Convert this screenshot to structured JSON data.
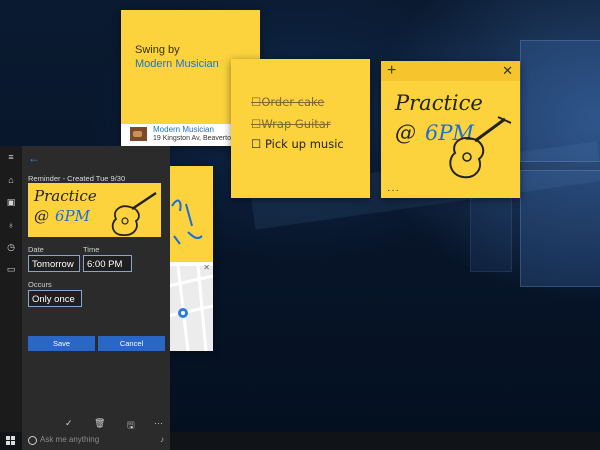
{
  "desktop_label": "Windows 10 desktop",
  "sticky_notes": {
    "note_1": {
      "line1": "Swing by",
      "line2": "Modern Musician",
      "attachment_title": "Modern Musician",
      "attachment_address": "19 Kingston Av, Beaverto"
    },
    "note_2": {
      "items": [
        {
          "text": "Order cake",
          "done": true
        },
        {
          "text": "Wrap Guitar",
          "done": true
        },
        {
          "text": "Pick up music",
          "done": false
        }
      ]
    },
    "note_3": {
      "line1": "Practice",
      "line2_prefix": "@",
      "line2_time": "6PM",
      "add_glyph": "+",
      "close_glyph": "✕",
      "menu_glyph": "···"
    }
  },
  "reminder_panel": {
    "back_glyph": "←",
    "header": "Reminder - Created Tue 9/30",
    "preview": {
      "line1": "Practice",
      "line2_prefix": "@",
      "line2_time": "6PM"
    },
    "date_label": "Date",
    "date_value": "Tomorrow",
    "time_label": "Time",
    "time_value": "6:00 PM",
    "occurs_label": "Occurs",
    "occurs_value": "Only once",
    "save_label": "Save",
    "cancel_label": "Cancel",
    "toolbar": {
      "check": "✓",
      "delete": "🗑",
      "save": "🖫",
      "more": "···"
    }
  },
  "app_bar": {
    "icons": [
      "hamburger-icon",
      "home-icon",
      "notebook-icon",
      "lightbulb-icon",
      "reminders-icon",
      "feedback-icon"
    ]
  },
  "taskbar": {
    "search_placeholder": "Ask me anything",
    "mic_glyph": "🎤"
  },
  "colors": {
    "sticky_yellow": "#fcd33c",
    "accent_blue": "#2a66c5",
    "link_blue": "#1d74c4",
    "panel_bg": "#2b2b2b"
  }
}
